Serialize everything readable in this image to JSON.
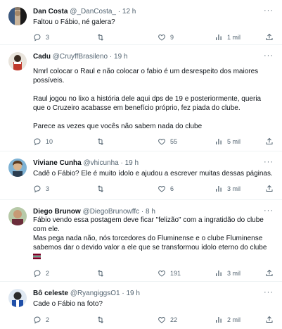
{
  "tweets": [
    {
      "name": "Dan Costa",
      "handle": "@_DanCosta_",
      "time": "12 h",
      "lines": [
        "Faltou o Fábio, né galera?"
      ],
      "replies": "3",
      "retweets": "",
      "likes": "9",
      "views": "1 mil"
    },
    {
      "name": "Cadu",
      "handle": "@CruyffBrasileno",
      "time": "19 h",
      "lines": [
        "Nmrl colocar o Raul e não colocar o fabio é um desrespeito dos maiores",
        "possíveis.",
        "",
        "Raul jogou no lixo a história dele aqui dps de 19 e posteriormente, queria",
        "que o Cruzeiro acabasse em benefício próprio, fez piada do clube.",
        "",
        "Parece as vezes que vocês não sabem nada do clube"
      ],
      "replies": "10",
      "retweets": "",
      "likes": "55",
      "views": "5 mil"
    },
    {
      "name": "Viviane Cunha",
      "handle": "@vhicunha",
      "time": "19 h",
      "lines": [
        "Cadê o Fábio? Ele é muito ídolo e ajudou a escrever muitas dessas páginas."
      ],
      "replies": "3",
      "retweets": "",
      "likes": "6",
      "views": "3 mil"
    },
    {
      "name": "Diego Brunow",
      "handle": "@DiegoBrunowffc",
      "time": "8 h",
      "lines": [
        "Fábio vendo essa postagem deve ficar \"felizão\" com a ingratidão do clube",
        "com ele.",
        "Mas pega nada não, nós torcedores do Fluminense e o clube Fluminense",
        "sabemos dar o devido valor a ele que se transformou ídolo eterno do clube"
      ],
      "replies": "2",
      "retweets": "",
      "likes": "191",
      "views": "3 mil"
    },
    {
      "name": "Bô celeste",
      "handle": "@RyangiggsO1",
      "time": "19 h",
      "lines": [
        "Cade o Fábio na foto?"
      ],
      "replies": "2",
      "retweets": "",
      "likes": "22",
      "views": "2 mil"
    }
  ],
  "icons": {
    "reply": "reply-icon",
    "retweet": "retweet-icon",
    "like": "like-icon",
    "views": "views-icon",
    "share": "share-icon",
    "more": "more-icon",
    "flag": "fluminense-flag-icon"
  },
  "colors": {
    "text": "#0f1419",
    "secondary": "#536471",
    "divider": "#eff3f4"
  }
}
